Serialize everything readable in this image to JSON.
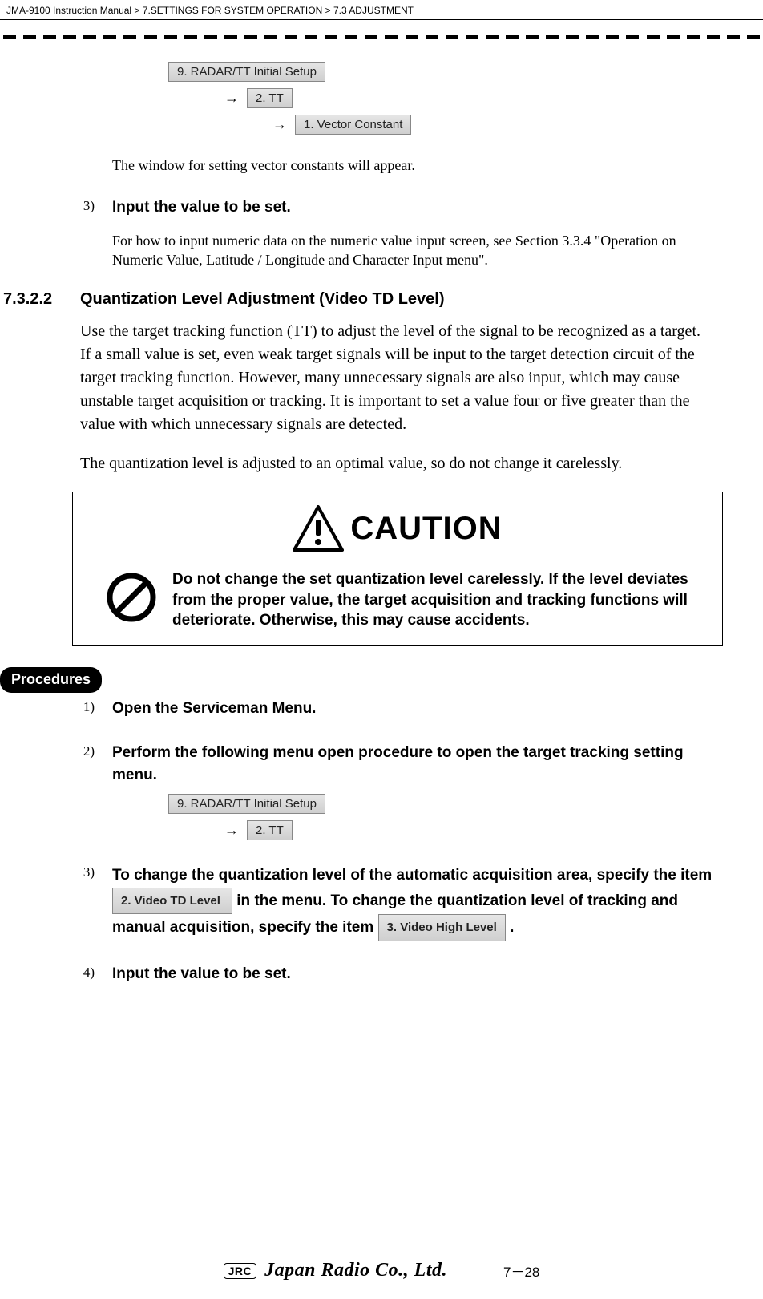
{
  "header": {
    "manual": "JMA-9100 Instruction Manual",
    "chapter": "7.SETTINGS FOR SYSTEM OPERATION",
    "section": "7.3  ADJUSTMENT"
  },
  "menu_chain_1": {
    "btn1": "9. RADAR/TT Initial Setup",
    "btn2": "2. TT",
    "btn3": "1. Vector Constant"
  },
  "after_chain_text": "The window for setting vector constants will appear.",
  "step3a": {
    "num": "3)",
    "title": "Input the value to be set.",
    "body": "For how to input numeric data on the numeric value input screen, see Section 3.3.4 \"Operation on Numeric Value, Latitude / Longitude and Character Input menu\"."
  },
  "sect": {
    "num": "7.3.2.2",
    "title": "Quantization Level Adjustment (Video TD Level)"
  },
  "para1": "Use the target tracking function (TT) to adjust the level of the signal to be recognized as a target. If a small value is set, even weak target signals will be input to the target detection circuit of the target tracking function. However, many unnecessary signals are also input, which may cause unstable target acquisition or tracking. It is important to set a value four or five greater than the value with which unnecessary signals are detected.",
  "para2": "The quantization level is adjusted to an optimal value, so do not change it carelessly.",
  "caution": {
    "word": "CAUTION",
    "text": "Do not change the set quantization level carelessly. If the level deviates from the proper value, the target acquisition and tracking functions will deteriorate. Otherwise, this may cause accidents."
  },
  "procedures_label": "Procedures",
  "proc1": {
    "num": "1)",
    "title": "Open the Serviceman Menu."
  },
  "proc2": {
    "num": "2)",
    "title": "Perform the following menu open procedure to open the target tracking setting menu."
  },
  "menu_chain_2": {
    "btn1": "9. RADAR/TT Initial Setup",
    "btn2": "2. TT"
  },
  "proc3": {
    "num": "3)",
    "pre": "To change the quantization level of the automatic acquisition area, specify the item ",
    "btn1": "2. Video TD Level",
    "mid": " in the menu. To change the quantization level of tracking and manual acquisition, specify the item ",
    "btn2": "3. Video High Level",
    "post": "."
  },
  "proc4": {
    "num": "4)",
    "title": "Input the value to be set."
  },
  "footer": {
    "jrc": "JRC",
    "company": "Japan Radio Co., Ltd.",
    "page": "7－28"
  }
}
